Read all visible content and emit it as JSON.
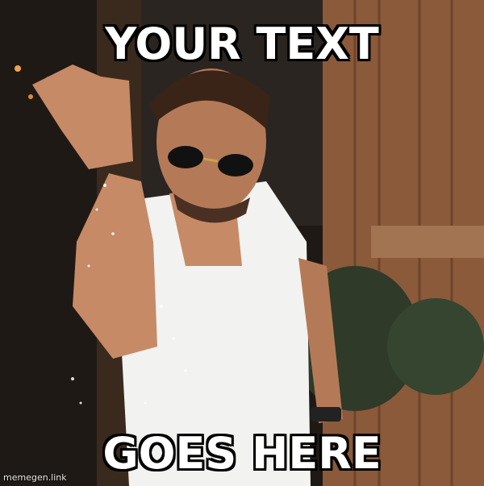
{
  "meme": {
    "top_text": "YOUR TEXT",
    "bottom_text": "GOES HERE",
    "watermark": "memegen.link"
  },
  "colors": {
    "caption_fill": "#ffffff",
    "caption_outline": "#000000",
    "wood_wall": "#8a5a3a",
    "shirt": "#f2f2f0",
    "skin": "#c68a66"
  }
}
